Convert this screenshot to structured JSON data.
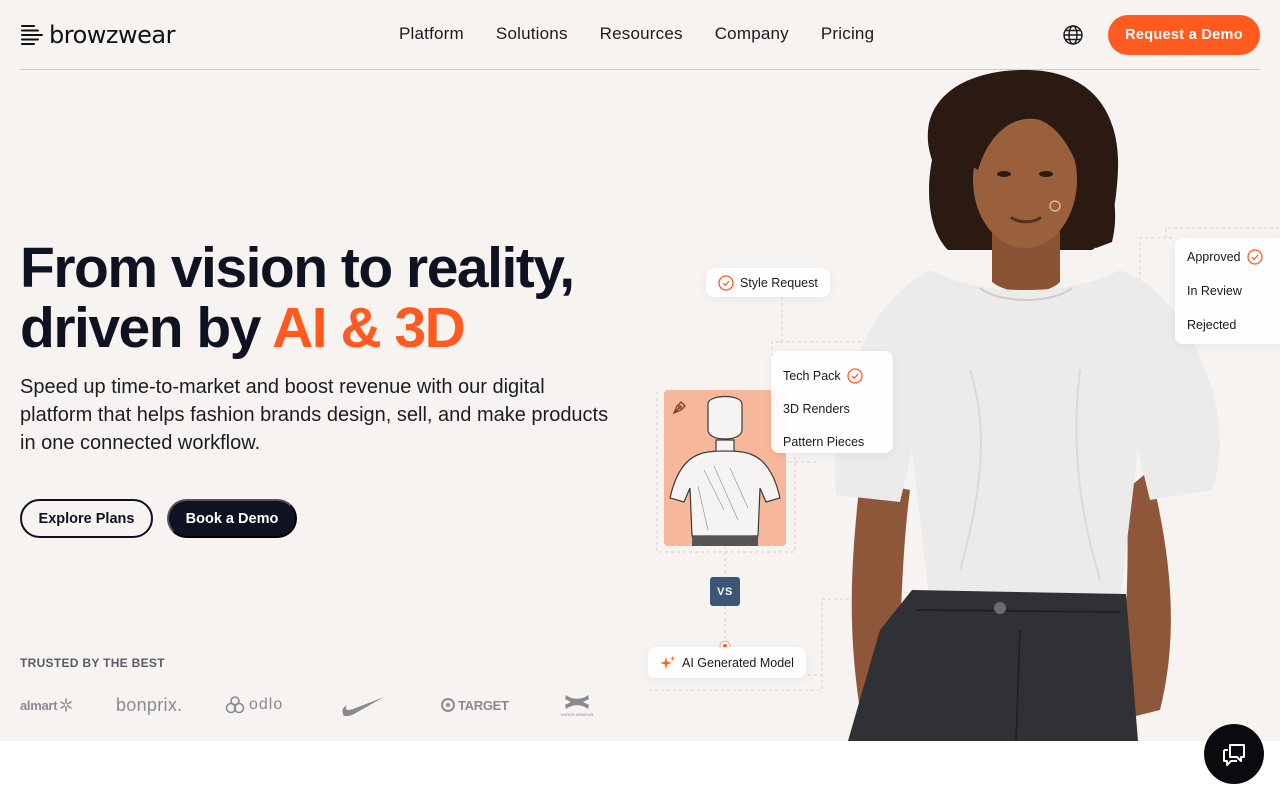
{
  "header": {
    "logo_text": "browzwear",
    "nav": [
      "Platform",
      "Solutions",
      "Resources",
      "Company",
      "Pricing"
    ],
    "language_icon": "globe-icon",
    "cta_label": "Request a Demo"
  },
  "hero": {
    "headline_line1": "From vision to reality,",
    "headline_line2_prefix": "driven by ",
    "headline_line2_accent": "AI & 3D",
    "subtext": "Speed up time-to-market and boost revenue with our digital platform that helps fashion brands design, sell, and make products in one connected workflow.",
    "explore_label": "Explore Plans",
    "book_label": "Book a Demo"
  },
  "trusted": {
    "label": "TRUSTED BY THE BEST",
    "brands": [
      "almart",
      "bonprix.",
      "odlo",
      "NIKE",
      "TARGET",
      "UNDER ARMOUR"
    ]
  },
  "workflow": {
    "style_request": "Style Request",
    "tech_pack": [
      "Tech Pack",
      "3D Renders",
      "Pattern Pieces"
    ],
    "status": [
      "Approved",
      "In Review",
      "Rejected"
    ],
    "vs_label": "VS",
    "ai_model": "AI Generated Model"
  },
  "colors": {
    "accent": "#ff5a1f",
    "dark": "#0f1220",
    "hero_bg": "#f7f3f1",
    "sketch_bg": "#f7b79b",
    "vs_bg": "#3b5676"
  },
  "chat_icon": "chat-icon"
}
